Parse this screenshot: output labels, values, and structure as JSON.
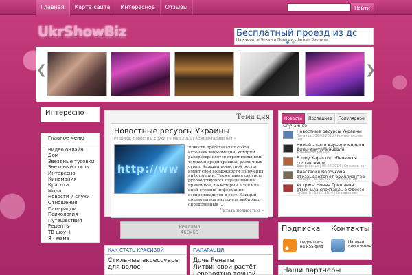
{
  "nav": {
    "items": [
      "Главная",
      "Карта сайта",
      "Интересное",
      "Отзывы"
    ]
  },
  "search": {
    "button": "Найти"
  },
  "logo": "UkrShowBiz",
  "ad": {
    "title": "Бесплатный проезд из дс",
    "subtitle": "На курорты Чехии и Польши с Janzen Звоните"
  },
  "interesting": {
    "title": "Интересно"
  },
  "main_menu": {
    "title": "Главное меню",
    "items": [
      "Видео онлайн",
      "Дом",
      "Звездные тусовки",
      "Звездный стиль",
      "Интересно",
      "Киномания",
      "Красота",
      "Мода",
      "Новости и слухи",
      "Отношения",
      "Папарацци",
      "Психология",
      "Путешествия",
      "Рецепты",
      "ТВ шоу +",
      "Я - мама"
    ]
  },
  "featured": {
    "header": "Тема дня",
    "title": "Новостные ресурсы Украины",
    "meta": "Рубрика: Новости и слухи | 6 Мар 2015 | Комментариев нет »",
    "image_text": "http://ww",
    "text": "Новости представляют собой источник информации, который распространяется стремительными темпами среди граждан различных стран. Каждый новостной ресурс имеет свои возможности получения информации. Также такие ресурсы руководствуются определенным принципом, по которым в той или иной степени информация воспроизводится в свет. Каждый пользователь интернета выбирает определенный ...",
    "more": "Читать полностью »"
  },
  "banner": {
    "line1": "Реклама",
    "line2": "468x60"
  },
  "tabs": [
    "Новости",
    "Последнее",
    "Популярное"
  ],
  "news": {
    "label": "Случайное",
    "items": [
      {
        "title": "Новостные ресурсы Украины",
        "meta": "Пятница | 06.03.2015 | Комментариев нет",
        "color": "#5a7fb5"
      },
      {
        "title": "Новый этап в карьере модели Аллы Костромичевой",
        "meta": "Понедельник | 09.06.2014 | Комментариев нет",
        "color": "#2a2a2a"
      },
      {
        "title": "В шоу Х-фактор обновится состав жюри",
        "meta": "Воскресенье | 08.06.2014 | Отзывов нет",
        "color": "#b5643a"
      },
      {
        "title": "Анастасия Волочкова отказывается от бриллиантов",
        "meta": "Четверг | 15.05.2014 | Отзывов нет",
        "color": "#7a6a58"
      },
      {
        "title": "Актриса Нонна Гришаева отменила спектакль в Одессе",
        "meta": "Суббота | 10.05.2014 | Отзывов нет",
        "color": "#a83a3a"
      }
    ]
  },
  "sections": [
    {
      "category": "КАК СТАТЬ КРАСИВОЙ",
      "title": "Стильные аксессуары для волос"
    },
    {
      "category": "ПАПАРАЦЦИ",
      "title": "Дочь Ренаты Литвиновой растёт невероятно точной"
    }
  ],
  "subscribe": {
    "title": "Подписка",
    "rss": "Подпишись на RSS-фид"
  },
  "contacts": {
    "title": "Контакты",
    "mail": "Напиши нам письмо"
  },
  "partners": {
    "title": "Наши партнеры"
  }
}
